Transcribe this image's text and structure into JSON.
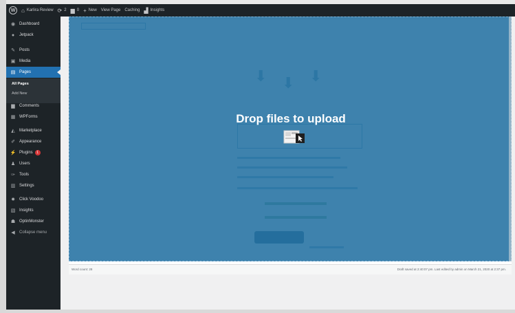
{
  "adminbar": {
    "site_name": "Karlira Review",
    "updates_count": "2",
    "comments_count": "0",
    "new_label": "New",
    "view_page_label": "View Page",
    "caching_label": "Caching",
    "insights_label": "Insights"
  },
  "sidebar": {
    "items": [
      {
        "label": "Dashboard",
        "icon": "dashboard-icon",
        "glyph": "◉"
      },
      {
        "label": "Jetpack",
        "icon": "jetpack-icon",
        "glyph": "●"
      },
      {
        "label": "Posts",
        "icon": "pin-icon",
        "glyph": "✎"
      },
      {
        "label": "Media",
        "icon": "media-icon",
        "glyph": "▣"
      },
      {
        "label": "Pages",
        "icon": "page-icon",
        "glyph": "▤"
      },
      {
        "label": "Comments",
        "icon": "comment-icon",
        "glyph": "▆"
      },
      {
        "label": "WPForms",
        "icon": "forms-icon",
        "glyph": "▦"
      },
      {
        "label": "Marketplace",
        "icon": "marketplace-icon",
        "glyph": "◭"
      },
      {
        "label": "Appearance",
        "icon": "brush-icon",
        "glyph": "✐"
      },
      {
        "label": "Plugins",
        "icon": "plugin-icon",
        "glyph": "⚡",
        "badge": "1"
      },
      {
        "label": "Users",
        "icon": "users-icon",
        "glyph": "♟"
      },
      {
        "label": "Tools",
        "icon": "wrench-icon",
        "glyph": "✑"
      },
      {
        "label": "Settings",
        "icon": "settings-icon",
        "glyph": "▥"
      },
      {
        "label": "Click Voodoo",
        "icon": "gear-icon",
        "glyph": "✹"
      },
      {
        "label": "Insights",
        "icon": "insights-icon",
        "glyph": "▧"
      },
      {
        "label": "OptinMonster",
        "icon": "monster-icon",
        "glyph": "☗"
      },
      {
        "label": "Collapse menu",
        "icon": "collapse-icon",
        "glyph": "◀"
      }
    ],
    "submenu": {
      "all_pages": "All Pages",
      "add_new": "Add New"
    }
  },
  "overlay": {
    "drop_text": "Drop files to upload"
  },
  "status": {
    "word_count": "Word count: 28",
    "draft_status": "Draft saved at 2:40:07 pm. Last edited by admin on March 21, 2020 at 2:37 pm."
  },
  "colors": {
    "accent": "#2271b1",
    "sidebar": "#1d2327",
    "overlay": "#1e6ea0"
  }
}
